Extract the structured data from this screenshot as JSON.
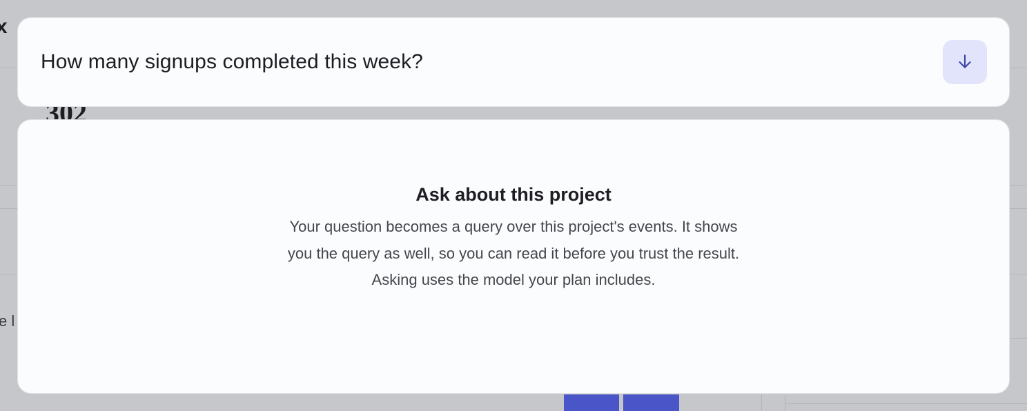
{
  "background": {
    "close_glyph": "x",
    "metric_value": "302",
    "snippet_text": "e l"
  },
  "question": {
    "text": "How many signups completed this week?",
    "button_icon": "arrow-down-icon"
  },
  "panel": {
    "title": "Ask about this project",
    "description": "Your question becomes a query over this project's events. It shows you the query as well, so you can read it before you trust the result. Asking uses the model your plan includes."
  },
  "colors": {
    "overlay": "#c6c7ca",
    "card": "#fbfcfe",
    "button_bg": "#e2e4fb",
    "accent": "#3c45a8",
    "bar": "#4a55c7"
  }
}
